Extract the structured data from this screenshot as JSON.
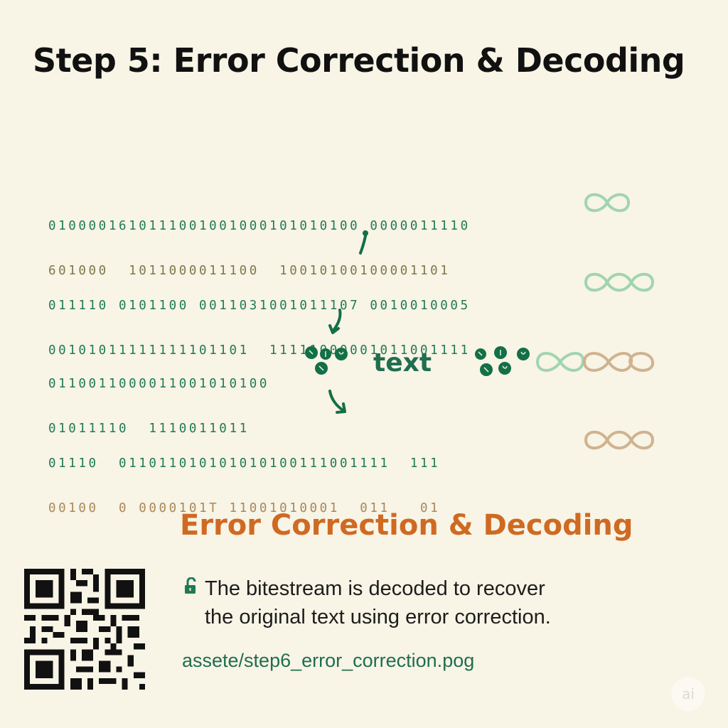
{
  "title": "Step 5: Error Correction & Decoding",
  "bitstream": {
    "row1": {
      "line1": "0100001610111001001000101010100 0000011110",
      "line2": "601000  1011000011100  10010100100001101"
    },
    "row2": {
      "line1": "011110 0101100 0011031001011107 0010010005",
      "line2": "00101011111111101101  11111000001011001111"
    },
    "row3": {
      "line1": "0110011000011001010100",
      "line2": "01011110  1110011011"
    },
    "row4": {
      "line1": "01110  011011010101010100111001111  111",
      "line2": "00100  0 0000101T 11001010001  011   01"
    }
  },
  "decoded_label": "text",
  "section_heading": "Error Correction & Decoding",
  "description": {
    "line1": "The bitestream is decoded to recover",
    "line2": "the original text using error correction."
  },
  "asset_path": "assete/step6_error_correction.pog",
  "badge": "ai",
  "colors": {
    "accent_green": "#1f7a55",
    "light_green": "#9fd5b0",
    "tan": "#cfb38f",
    "orange": "#cf6a22",
    "background": "#f8f4e6"
  },
  "icons": {
    "lock": "unlocked-padlock-icon",
    "loop": "infinity-loop-icon",
    "arrow": "curved-down-arrow-icon",
    "qr": "qr-code-icon"
  }
}
